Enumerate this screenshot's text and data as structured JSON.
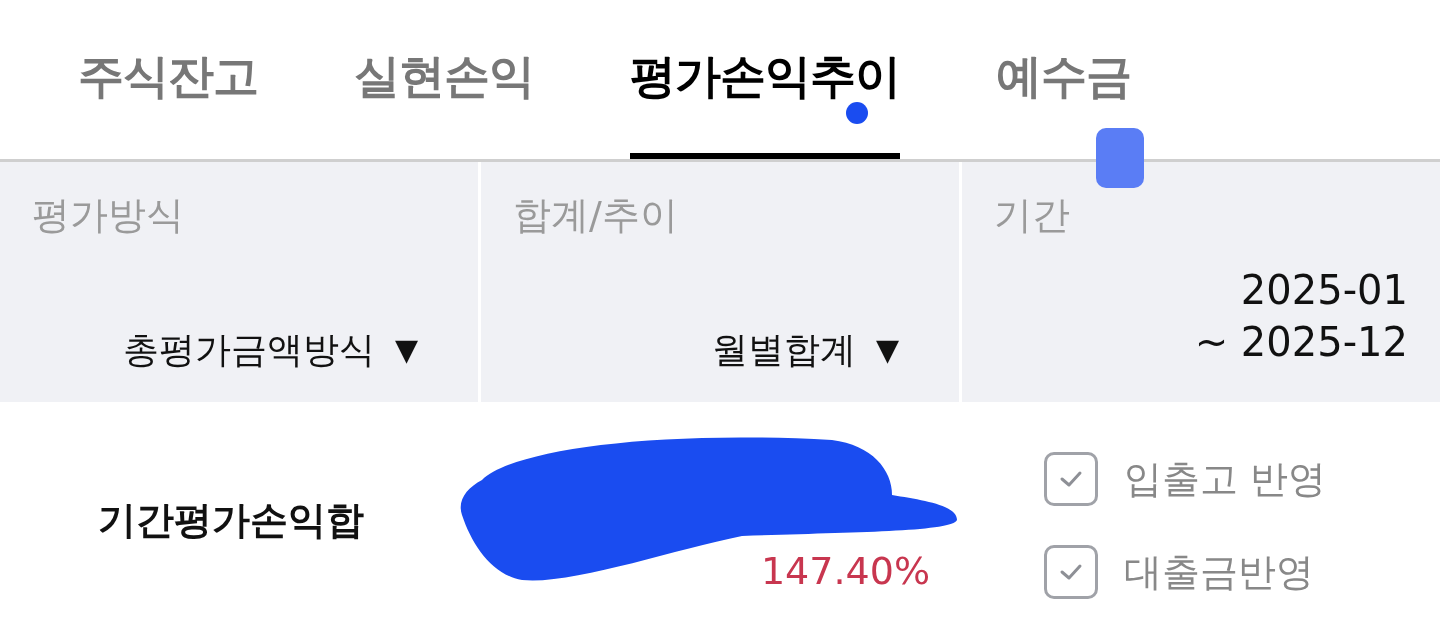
{
  "tabs": [
    {
      "label": "주식잔고",
      "selected": false
    },
    {
      "label": "실현손익",
      "selected": false
    },
    {
      "label": "평가손익추이",
      "selected": true
    },
    {
      "label": "예수금",
      "selected": false
    }
  ],
  "filters": [
    {
      "label": "평가방식",
      "kind": "dropdown",
      "value": "총평가금액방식",
      "arrow": "▼"
    },
    {
      "label": "합계/추이",
      "kind": "dropdown",
      "value": "월별합계",
      "arrow": "▼"
    },
    {
      "label": "기간",
      "kind": "range",
      "lines": [
        "2025-01",
        "~ 2025-12"
      ]
    }
  ],
  "summary": {
    "label": "기간평가손익합",
    "rate": "147.40%"
  },
  "options": [
    {
      "label": "입출고 반영",
      "checked": true
    },
    {
      "label": "대출금반영",
      "checked": true
    }
  ]
}
